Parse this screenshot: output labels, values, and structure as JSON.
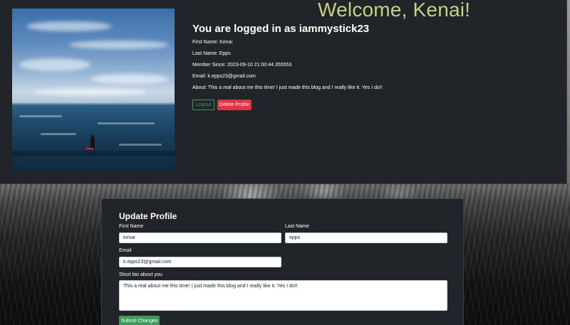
{
  "profile": {
    "welcome": "Welcome, Kenai!",
    "logged_in": "You are logged in as iammystick23",
    "first_name": "First Name: Kenai",
    "last_name": "Last Name: Epps",
    "member_since": "Member Since: 2023-09-10 21:00:44.355553",
    "email": "Email: k.epps23@gmail.com",
    "about": "About: This a real about me this time! I just made this blog and I really like it. Yes I do!!",
    "logout_label": "Logout",
    "delete_label": "Delete Profile",
    "photo_icon": "profile-photo-ocean-paddleboarder"
  },
  "form": {
    "title": "Update Profile",
    "first_name_label": "First Name",
    "first_name_value": "kenai",
    "last_name_label": "Last Name",
    "last_name_value": "epps",
    "email_label": "Email",
    "email_value": "k.epps23@gmail.com",
    "bio_label": "Short bio about you",
    "bio_value": "This a real about me this time! I just made this blog and I really like it. Yes I do!!",
    "submit_label": "Submit Changes"
  },
  "colors": {
    "welcome": "#c2d37a",
    "success": "#3e9b5c",
    "danger": "#dc3545",
    "card_bg": "#212529"
  }
}
